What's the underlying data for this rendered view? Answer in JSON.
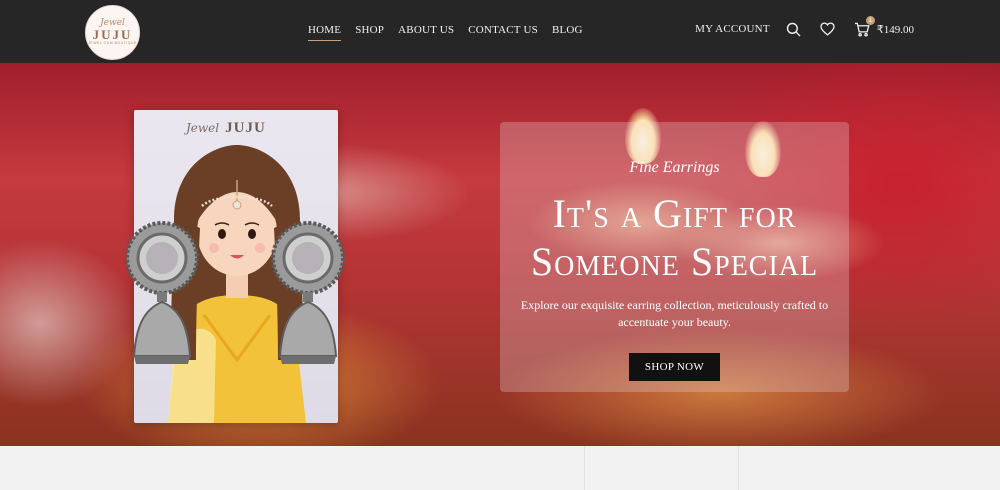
{
  "header": {
    "logo": {
      "script": "Jewel",
      "main": "JUJU",
      "tagline": "JEWEL CUM BOUTIQUE"
    },
    "nav": [
      {
        "label": "HOME",
        "active": true
      },
      {
        "label": "SHOP",
        "active": false
      },
      {
        "label": "ABOUT US",
        "active": false
      },
      {
        "label": "CONTACT US",
        "active": false
      },
      {
        "label": "BLOG",
        "active": false
      }
    ],
    "account_label": "MY ACCOUNT",
    "icons": [
      "search-icon",
      "heart-icon",
      "cart-icon"
    ],
    "cart": {
      "count": "1",
      "total": "₹149.00"
    }
  },
  "hero": {
    "card_brand": {
      "script": "Jewel",
      "main": "JUJU"
    },
    "eyebrow": "Fine Earrings",
    "headline_line1": "It's a Gift for",
    "headline_line2": "Someone Special",
    "subtext": "Explore our exquisite earring collection, meticulously crafted to accentuate your beauty.",
    "cta_label": "SHOP NOW"
  },
  "colors": {
    "header_bg": "#262626",
    "accent": "#c9a27a",
    "button_bg": "#111111"
  }
}
